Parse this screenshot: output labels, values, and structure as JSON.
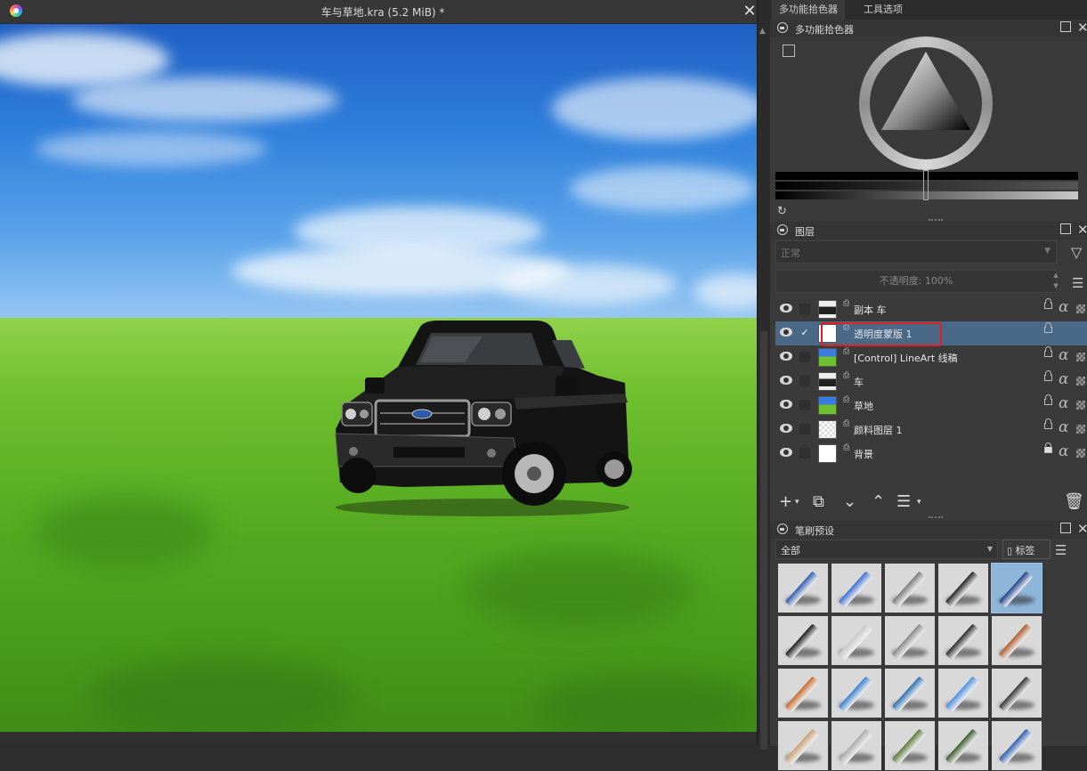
{
  "document": {
    "title": "车与草地.kra (5.2 MiB) *",
    "close_glyph": "✕"
  },
  "dock": {
    "tabs": [
      "多功能拾色器",
      "工具选项"
    ]
  },
  "color_selector": {
    "title": "多功能拾色器",
    "reset_glyph": "↻"
  },
  "layers": {
    "title": "图层",
    "blend_mode": "正常",
    "opacity_label": "不透明度:  100%",
    "items": [
      {
        "name": "副本 车",
        "visible": true,
        "checked": false,
        "selected": false,
        "locked": false,
        "thumb": "car"
      },
      {
        "name": "透明度蒙版 1",
        "visible": true,
        "checked": true,
        "selected": true,
        "locked": false,
        "thumb": "white"
      },
      {
        "name": "[Control] LineArt 线稿",
        "visible": true,
        "checked": false,
        "selected": false,
        "locked": false,
        "thumb": "grass"
      },
      {
        "name": "车",
        "visible": true,
        "checked": false,
        "selected": false,
        "locked": false,
        "thumb": "car"
      },
      {
        "name": "草地",
        "visible": true,
        "checked": false,
        "selected": false,
        "locked": false,
        "thumb": "grass"
      },
      {
        "name": "颜料图层 1",
        "visible": true,
        "checked": false,
        "selected": false,
        "locked": false,
        "thumb": "checker"
      },
      {
        "name": "背景",
        "visible": true,
        "checked": false,
        "selected": false,
        "locked": true,
        "thumb": "white"
      }
    ],
    "check_glyph": "✓",
    "alpha_glyph": "α"
  },
  "brush_presets": {
    "title": "笔刷预设",
    "filter": "全部",
    "tag_label": "标签",
    "selected_index": 4
  },
  "colors": {
    "accent_selection": "#4a6986",
    "highlight_box": "#e02020"
  }
}
